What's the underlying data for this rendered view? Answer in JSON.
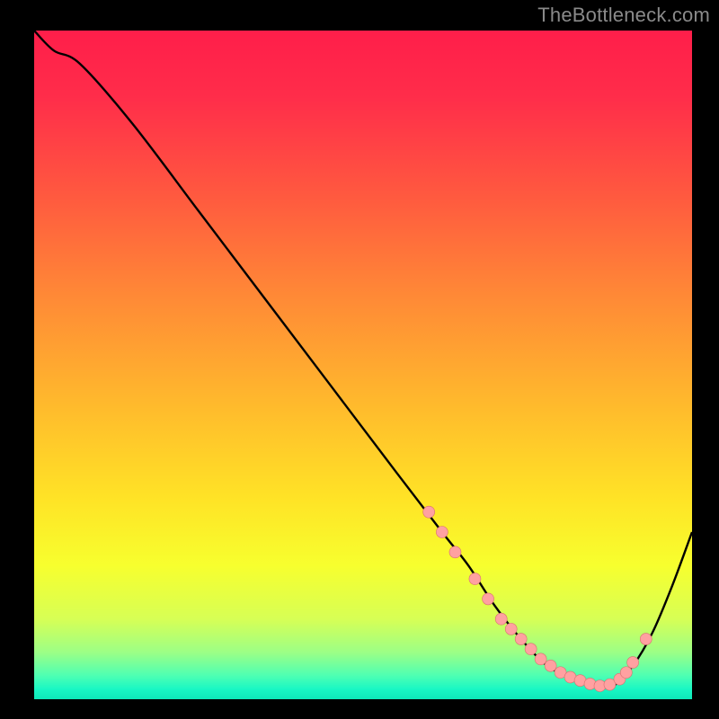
{
  "attribution": "TheBottleneck.com",
  "colors": {
    "gradient_stops": [
      {
        "offset": 0.0,
        "color": "#ff1e4a"
      },
      {
        "offset": 0.1,
        "color": "#ff2d4a"
      },
      {
        "offset": 0.25,
        "color": "#ff5a3f"
      },
      {
        "offset": 0.4,
        "color": "#ff8a36"
      },
      {
        "offset": 0.55,
        "color": "#ffb72d"
      },
      {
        "offset": 0.7,
        "color": "#ffe326"
      },
      {
        "offset": 0.8,
        "color": "#f7ff2e"
      },
      {
        "offset": 0.88,
        "color": "#d7ff55"
      },
      {
        "offset": 0.93,
        "color": "#9cff86"
      },
      {
        "offset": 0.965,
        "color": "#4dffb3"
      },
      {
        "offset": 0.985,
        "color": "#19f7c4"
      },
      {
        "offset": 1.0,
        "color": "#0de8b8"
      }
    ],
    "curve": "#000000",
    "marker": "#ffa1a1",
    "marker_stroke": "#d96f6f"
  },
  "chart_data": {
    "type": "line",
    "title": "",
    "xlabel": "",
    "ylabel": "",
    "xlim": [
      0,
      100
    ],
    "ylim": [
      0,
      100
    ],
    "series": [
      {
        "name": "bottleneck-curve",
        "x": [
          0,
          3,
          7,
          15,
          25,
          35,
          45,
          55,
          62,
          66,
          70,
          74,
          78,
          82,
          85,
          88,
          91,
          94,
          97,
          100
        ],
        "y": [
          100,
          97,
          95,
          86,
          73,
          60,
          47,
          34,
          25,
          20,
          14,
          9,
          5,
          3,
          2,
          2,
          5,
          10,
          17,
          25
        ]
      }
    ],
    "markers": {
      "name": "highlight-points",
      "x": [
        60,
        62,
        64,
        67,
        69,
        71,
        72.5,
        74,
        75.5,
        77,
        78.5,
        80,
        81.5,
        83,
        84.5,
        86,
        87.5,
        89,
        90,
        91,
        93
      ],
      "y": [
        28,
        25,
        22,
        18,
        15,
        12,
        10.5,
        9,
        7.5,
        6,
        5,
        4,
        3.3,
        2.8,
        2.3,
        2,
        2.2,
        3,
        4,
        5.5,
        9
      ]
    }
  }
}
